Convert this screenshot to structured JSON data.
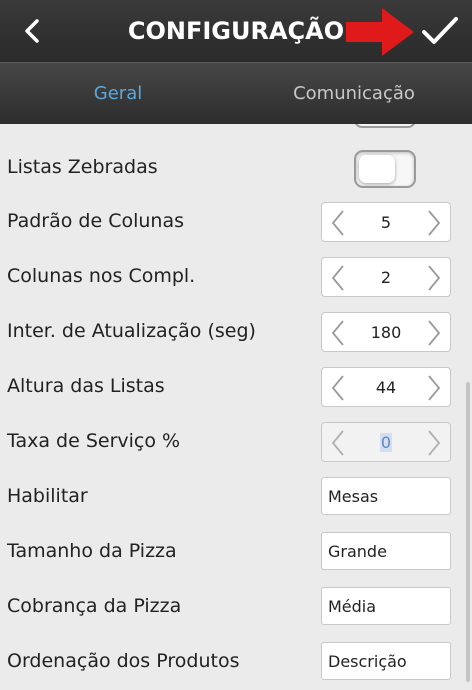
{
  "header": {
    "title": "CONFIGURAÇÃO",
    "back_icon": "chevron-left-icon",
    "confirm_icon": "check-icon",
    "annotation_arrow_color": "#e0191b"
  },
  "tabs": [
    {
      "label": "Geral",
      "active": true
    },
    {
      "label": "Comunicação",
      "active": false
    }
  ],
  "colors": {
    "header_bg": "#2e2e2e",
    "active_tab": "#5aa8e0",
    "content_bg": "#ebebeb"
  },
  "settings": [
    {
      "label": "Listas Zebradas",
      "control": "toggle",
      "value": "off"
    },
    {
      "label": "Padrão de Colunas",
      "control": "stepper",
      "value": "5"
    },
    {
      "label": "Colunas nos Compl.",
      "control": "stepper",
      "value": "2"
    },
    {
      "label": "Inter. de Atualização (seg)",
      "control": "stepper",
      "value": "180"
    },
    {
      "label": "Altura das Listas",
      "control": "stepper",
      "value": "44"
    },
    {
      "label": "Taxa de Serviço %",
      "control": "stepper",
      "value": "0",
      "state": "disabled"
    },
    {
      "label": "Habilitar",
      "control": "select",
      "value": "Mesas"
    },
    {
      "label": "Tamanho da Pizza",
      "control": "select",
      "value": "Grande"
    },
    {
      "label": "Cobrança da Pizza",
      "control": "select",
      "value": "Média"
    },
    {
      "label": "Ordenação dos Produtos",
      "control": "select",
      "value": "Descrição"
    }
  ]
}
